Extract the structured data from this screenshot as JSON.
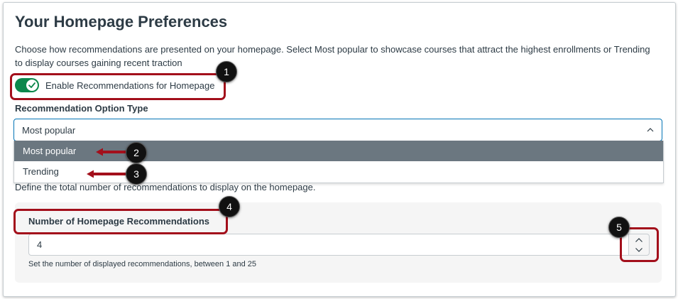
{
  "page": {
    "title": "Your Homepage Preferences",
    "description": "Choose how recommendations are presented on your homepage. Select Most popular to showcase courses that attract the highest enrollments or Trending to display courses gaining recent traction"
  },
  "toggle": {
    "label": "Enable Recommendations for Homepage",
    "state": "on",
    "color": "#0b874b"
  },
  "recommendation_type": {
    "label": "Recommendation Option Type",
    "selected_value": "Most popular",
    "options": [
      "Most popular",
      "Trending"
    ]
  },
  "total": {
    "description": "Define the total number of recommendations to display on the homepage."
  },
  "number_field": {
    "label": "Number of Homepage Recommendations",
    "value": "4",
    "hint": "Set the number of displayed recommendations, between 1 and 25"
  },
  "callouts": [
    "1",
    "2",
    "3",
    "4",
    "5"
  ],
  "annotation_color": "#a30f1b",
  "accent_color": "#0374b5"
}
